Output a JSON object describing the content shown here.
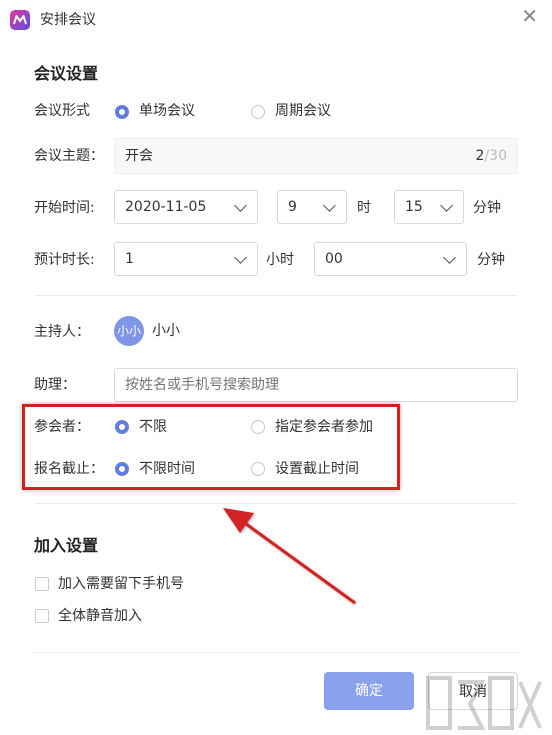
{
  "window": {
    "title": "安排会议",
    "close_glyph": "✕"
  },
  "meeting_settings": {
    "section_title": "会议设置",
    "format": {
      "label": "会议形式",
      "options": [
        "单场会议",
        "周期会议"
      ],
      "selected": "单场会议"
    },
    "topic": {
      "label": "会议主题：",
      "value": "开会",
      "count": "2",
      "max": "/30"
    },
    "start_time": {
      "label": "开始时间:",
      "date": "2020-11-05",
      "hour": "9",
      "hour_unit": "时",
      "minute": "15",
      "minute_unit": "分钟"
    },
    "duration": {
      "label": "预计时长:",
      "hours": "1",
      "hours_unit": "小时",
      "minutes": "00",
      "minutes_unit": "分钟"
    }
  },
  "host": {
    "label": "主持人：",
    "avatar_text": "小小",
    "name": "小小"
  },
  "assistant": {
    "label": "助理：",
    "placeholder": "按姓名或手机号搜索助理"
  },
  "participants": {
    "label": "参会者：",
    "options": [
      "不限",
      "指定参会者参加"
    ],
    "selected": "不限"
  },
  "deadline": {
    "label": "报名截止：",
    "options": [
      "不限时间",
      "设置截止时间"
    ],
    "selected": "不限时间"
  },
  "join_settings": {
    "section_title": "加入设置",
    "options": [
      {
        "label": "加入需要留下手机号",
        "checked": false
      },
      {
        "label": "全体静音加入",
        "checked": false
      }
    ]
  },
  "footer": {
    "confirm_label": "确定",
    "cancel_label": "取消"
  },
  "colors": {
    "accent": "#5f7fe0",
    "confirm_button": "#8aa1ec",
    "highlight_annotation": "#d32020"
  }
}
